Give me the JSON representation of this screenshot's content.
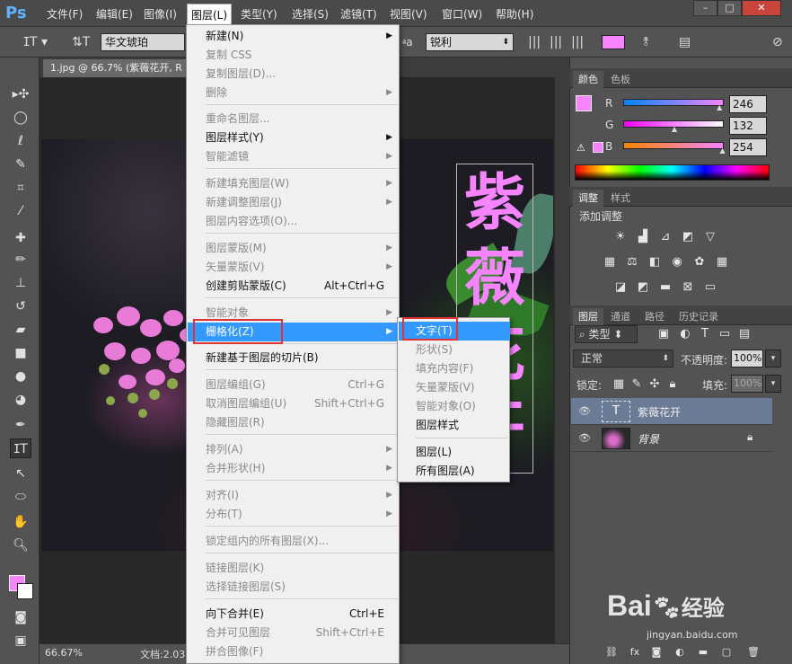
{
  "app": {
    "logo": "Ps"
  },
  "menubar": {
    "items": [
      "文件(F)",
      "编辑(E)",
      "图像(I)",
      "图层(L)",
      "类型(Y)",
      "选择(S)",
      "滤镜(T)",
      "视图(V)",
      "窗口(W)",
      "帮助(H)"
    ],
    "active_index": 3
  },
  "window_controls": {
    "minimize": "–",
    "maximize": "□",
    "close": "✕"
  },
  "options_bar": {
    "font_family": "华文琥珀",
    "aa_label": "a",
    "antialias": "锐利",
    "text_color": "#f684fe"
  },
  "document": {
    "tab_title": "1.jpg @ 66.7% (紫薇花开, R",
    "text_chars": [
      "紫",
      "薇",
      "花",
      "开"
    ]
  },
  "statusbar": {
    "zoom": "66.67%",
    "doc_info": "文档:2.03"
  },
  "color_panel": {
    "tabs": [
      "颜色",
      "色板"
    ],
    "swatch": "#f684fe",
    "r_label": "R",
    "g_label": "G",
    "b_label": "B",
    "r": "246",
    "g": "132",
    "b": "254",
    "r_pct": 0.965,
    "g_pct": 0.518,
    "b_pct": 0.996
  },
  "adjust_panel": {
    "tabs": [
      "调整",
      "样式"
    ],
    "title": "添加调整"
  },
  "layers_panel": {
    "tabs": [
      "图层",
      "通道",
      "路径",
      "历史记录"
    ],
    "filter_kind": "类型",
    "blend_mode": "正常",
    "opacity_label": "不透明度:",
    "opacity": "100%",
    "lock_label": "锁定:",
    "fill_label": "填充:",
    "fill": "100%",
    "layers": [
      {
        "name": "紫薇花开",
        "type": "text",
        "thumb_glyph": "T",
        "selected": true
      },
      {
        "name": "背景",
        "type": "image",
        "selected": false
      }
    ]
  },
  "layer_menu": {
    "items": [
      {
        "label": "新建(N)",
        "disabled": false,
        "arrow": true
      },
      {
        "label": "复制 CSS",
        "disabled": true
      },
      {
        "label": "复制图层(D)...",
        "disabled": true
      },
      {
        "label": "删除",
        "disabled": true,
        "arrow": true
      },
      {
        "label": "重命名图层...",
        "disabled": true
      },
      {
        "label": "图层样式(Y)",
        "disabled": false,
        "arrow": true
      },
      {
        "label": "智能滤镜",
        "disabled": true,
        "arrow": true
      },
      {
        "label": "新建填充图层(W)",
        "disabled": true,
        "arrow": true
      },
      {
        "label": "新建调整图层(J)",
        "disabled": true,
        "arrow": true
      },
      {
        "label": "图层内容选项(O)...",
        "disabled": true
      },
      {
        "label": "图层蒙版(M)",
        "disabled": true,
        "arrow": true
      },
      {
        "label": "矢量蒙版(V)",
        "disabled": true,
        "arrow": true
      },
      {
        "label": "创建剪贴蒙版(C)",
        "disabled": false,
        "shortcut": "Alt+Ctrl+G"
      },
      {
        "label": "智能对象",
        "disabled": true,
        "arrow": true
      },
      {
        "label": "栅格化(Z)",
        "disabled": false,
        "arrow": true,
        "highlight": true
      },
      {
        "label": "新建基于图层的切片(B)",
        "disabled": false
      },
      {
        "label": "图层编组(G)",
        "disabled": true,
        "shortcut": "Ctrl+G"
      },
      {
        "label": "取消图层编组(U)",
        "disabled": true,
        "shortcut": "Shift+Ctrl+G"
      },
      {
        "label": "隐藏图层(R)",
        "disabled": true
      },
      {
        "label": "排列(A)",
        "disabled": true,
        "arrow": true
      },
      {
        "label": "合并形状(H)",
        "disabled": true,
        "arrow": true
      },
      {
        "label": "对齐(I)",
        "disabled": true,
        "arrow": true
      },
      {
        "label": "分布(T)",
        "disabled": true,
        "arrow": true
      },
      {
        "label": "锁定组内的所有图层(X)...",
        "disabled": true
      },
      {
        "label": "链接图层(K)",
        "disabled": true
      },
      {
        "label": "选择链接图层(S)",
        "disabled": true
      },
      {
        "label": "向下合并(E)",
        "disabled": false,
        "shortcut": "Ctrl+E"
      },
      {
        "label": "合并可见图层",
        "disabled": true,
        "shortcut": "Shift+Ctrl+E"
      },
      {
        "label": "拼合图像(F)",
        "disabled": true
      }
    ]
  },
  "rasterize_submenu": {
    "items": [
      {
        "label": "文字(T)",
        "disabled": false,
        "highlight": true
      },
      {
        "label": "形状(S)",
        "disabled": true
      },
      {
        "label": "填充内容(F)",
        "disabled": true
      },
      {
        "label": "矢量蒙版(V)",
        "disabled": true
      },
      {
        "label": "智能对象(O)",
        "disabled": true
      },
      {
        "label": "图层样式",
        "disabled": false
      },
      {
        "label": "图层(L)",
        "disabled": false
      },
      {
        "label": "所有图层(A)",
        "disabled": false
      }
    ]
  },
  "watermark": {
    "brand": "Bai",
    "brand2": "经验",
    "url": "jingyan.baidu.com"
  },
  "colors": {
    "accent": "#3399ff",
    "highlight_box": "#e03434",
    "text_fill": "#f684fe"
  }
}
